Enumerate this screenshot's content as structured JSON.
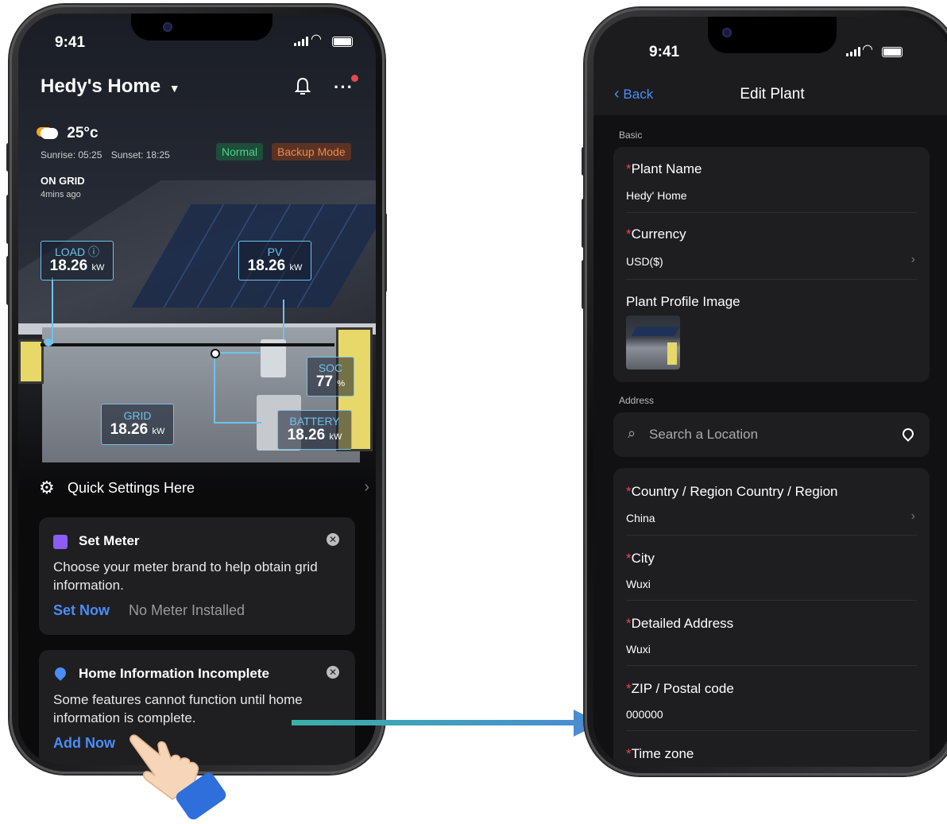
{
  "left_phone": {
    "status_time": "9:41",
    "home_title": "Hedy's Home",
    "weather": {
      "temp": "25°c",
      "sunrise": "Sunrise: 05:25",
      "sunset": "Sunset: 18:25"
    },
    "badges": {
      "normal": "Normal",
      "backup": "Backup Mode"
    },
    "grid_status": {
      "title": "ON GRID",
      "ago": "4mins ago"
    },
    "tags": {
      "load": {
        "label": "LOAD ⓘ",
        "value": "18.26",
        "unit": "kW"
      },
      "pv": {
        "label": "PV",
        "value": "18.26",
        "unit": "kW"
      },
      "soc": {
        "label": "SOC",
        "value": "77",
        "unit": "%"
      },
      "grid": {
        "label": "GRID",
        "value": "18.26",
        "unit": "kW"
      },
      "battery": {
        "label": "BATTERY",
        "value": "18.26",
        "unit": "kW"
      }
    },
    "quick_settings": "Quick Settings Here",
    "meter_card": {
      "title": "Set Meter",
      "text": "Choose your meter brand to help obtain grid information.",
      "action": "Set Now",
      "status": "No Meter Installed"
    },
    "home_info_card": {
      "title": "Home Information Incomplete",
      "text": "Some features cannot function until home information is complete.",
      "action": "Add Now"
    }
  },
  "right_phone": {
    "status_time": "9:41",
    "nav": {
      "back": "Back",
      "title": "Edit Plant"
    },
    "section_basic": "Basic",
    "plant_name": {
      "label": "Plant Name",
      "value": "Hedy' Home"
    },
    "currency": {
      "label": "Currency",
      "value": "USD($)"
    },
    "profile_image": {
      "label": "Plant Profile Image"
    },
    "section_address": "Address",
    "search": {
      "placeholder": "Search a Location"
    },
    "country": {
      "label": "Country / Region Country / Region",
      "value": "China"
    },
    "city": {
      "label": "City",
      "value": "Wuxi"
    },
    "detailed_address": {
      "label": "Detailed Address",
      "value": "Wuxi"
    },
    "zip": {
      "label": "ZIP / Postal code",
      "value": "000000"
    },
    "timezone": {
      "label": "Time zone"
    }
  },
  "colors": {
    "accent_blue": "#4a8df8",
    "tag_cyan": "#6fc2ea",
    "required_red": "#e5484d",
    "arrow": "#3fb6b0"
  }
}
